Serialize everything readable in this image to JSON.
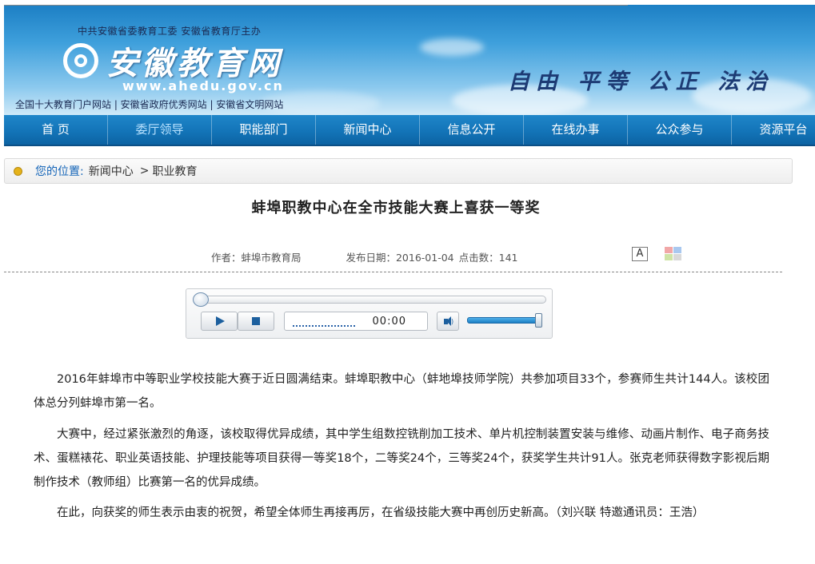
{
  "header": {
    "sponsor": "中共安徽省委教育工委  安徽省教育厅主办",
    "site_name": "安徽教育网",
    "site_url": "www.ahedu.gov.cn",
    "honors": "全国十大教育门户网站 | 安徽省政府优秀网站 | 安徽省文明网站",
    "slogan": "自由 平等 公正 法治"
  },
  "nav": {
    "items": [
      "首 页",
      "委厅领导",
      "职能部门",
      "新闻中心",
      "信息公开",
      "在线办事",
      "公众参与",
      "资源平台"
    ],
    "active": "委厅领导"
  },
  "breadcrumb": {
    "label": "您的位置:",
    "items": [
      "新闻中心",
      "职业教育"
    ],
    "separator": ">"
  },
  "article": {
    "title": "蚌埠职教中心在全市技能大赛上喜获一等奖",
    "author": "作者：蚌埠市教育局",
    "date": "发布日期：2016-01-04",
    "hits": "点击数：141",
    "font_size_label": "A",
    "paragraphs": [
      "2016年蚌埠市中等职业学校技能大赛于近日圆满结束。蚌埠职教中心（蚌地埠技师学院）共参加项目33个，参赛师生共计144人。该校团体总分列蚌埠市第一名。",
      "大赛中，经过紧张激烈的角逐，该校取得优异成绩，其中学生组数控铣削加工技术、单片机控制装置安装与维修、动画片制作、电子商务技术、蛋糕裱花、职业英语技能、护理技能等项目获得一等奖18个，二等奖24个，三等奖24个，获奖学生共计91人。张克老师获得数字影视后期制作技术（教师组）比赛第一名的优异成绩。",
      "在此，向获奖的师生表示由衷的祝贺，希望全体师生再接再厉，在省级技能大赛中再创历史新高。（刘兴联 特邀通讯员：王浩）"
    ]
  },
  "player": {
    "time": "00:00",
    "progress": 0,
    "volume": 1.0
  },
  "colors": {
    "nav_bg": "#1374b8",
    "link": "#1565b8",
    "accent": "#1c5f9e"
  }
}
